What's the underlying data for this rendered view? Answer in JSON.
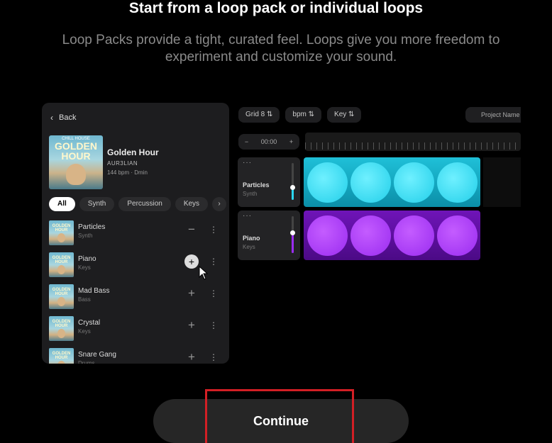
{
  "header": {
    "title": "Start from a loop pack or individual loops",
    "subtitle": "Loop Packs provide a tight, curated feel. Loops give you more freedom to experiment and customize your sound."
  },
  "panel": {
    "back_label": "Back",
    "album": {
      "art_small": "CHILL HOUSE",
      "art_text": "GOLDEN HOUR",
      "title": "Golden Hour",
      "artist": "AUR3LIAN",
      "meta": "144 bpm · Dmin"
    },
    "filters": [
      "All",
      "Synth",
      "Percussion",
      "Keys"
    ],
    "active_filter": "All",
    "thumb_text": "GOLDEN HOUR",
    "loops": [
      {
        "name": "Particles",
        "type": "Synth",
        "action": "−"
      },
      {
        "name": "Piano",
        "type": "Keys",
        "action": "+"
      },
      {
        "name": "Mad Bass",
        "type": "Bass",
        "action": "+"
      },
      {
        "name": "Crystal",
        "type": "Keys",
        "action": "+"
      },
      {
        "name": "Snare Gang",
        "type": "Drums",
        "action": "+"
      }
    ]
  },
  "editor": {
    "grid_label": "Grid 8",
    "bpm_label": "bpm",
    "key_label": "Key",
    "project_placeholder": "Project Name",
    "time": "00:00",
    "minus": "−",
    "plus": "+",
    "tracks": [
      {
        "name": "Particles",
        "type": "Synth",
        "color": "#2bd6f0",
        "level": 0.35
      },
      {
        "name": "Piano",
        "type": "Keys",
        "color": "#9b2cf5",
        "level": 0.55
      }
    ]
  },
  "continue_label": "Continue",
  "colors": {
    "accent_cyan": "#2bd6f0",
    "accent_purple": "#9b2cf5",
    "highlight": "#d21f25"
  }
}
